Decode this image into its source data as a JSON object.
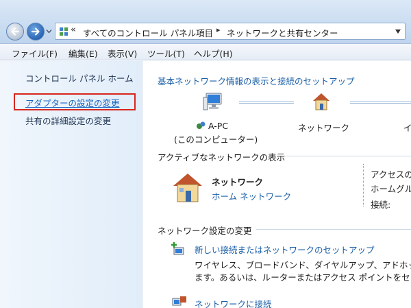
{
  "address_bar": {
    "overflow": "«",
    "crumbs": [
      "すべてのコントロール パネル項目",
      "ネットワークと共有センター"
    ],
    "separator": "▸"
  },
  "menu": [
    "ファイル(F)",
    "編集(E)",
    "表示(V)",
    "ツール(T)",
    "ヘルプ(H)"
  ],
  "sidebar": {
    "home": "コントロール パネル ホーム",
    "adapter": "アダプターの設定の変更",
    "advanced": "共有の詳細設定の変更"
  },
  "main": {
    "basic_heading": "基本ネットワーク情報の表示と接続のセットアップ",
    "computer_name": "A-PC",
    "computer_sub": "(このコンピューター)",
    "network_label": "ネットワーク",
    "internet_partial": "イ",
    "active_heading": "アクティブなネットワークの表示",
    "active_network_name": "ネットワーク",
    "active_network_type": "ホーム ネットワーク",
    "access_type_label": "アクセスの",
    "homegroup_label": "ホームグル",
    "connection_label": "接続:",
    "change_heading": "ネットワーク設定の変更",
    "setup_link": "新しい接続またはネットワークのセットアップ",
    "setup_desc_1": "ワイヤレス、ブロードバンド、ダイヤルアップ、アドホック",
    "setup_desc_2": "ます。あるいは、ルーターまたはアクセス ポイントをセッ",
    "connect_link": "ネットワークに接続"
  }
}
